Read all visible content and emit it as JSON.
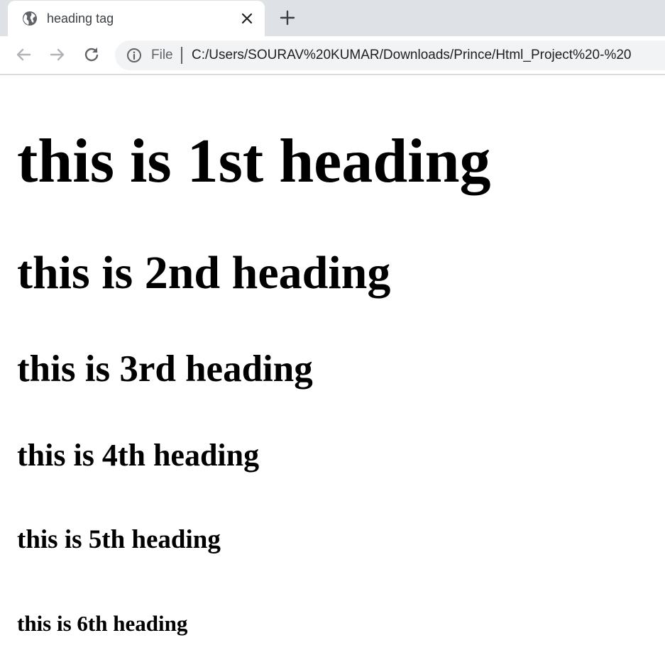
{
  "browser": {
    "tab": {
      "title": "heading tag",
      "favicon": "globe-icon"
    },
    "new_tab_icon": "plus-icon",
    "nav": {
      "back_icon": "back-arrow-icon",
      "forward_icon": "forward-arrow-icon",
      "reload_icon": "reload-icon"
    },
    "omnibox": {
      "info_icon": "info-icon",
      "scheme": "File",
      "url": "C:/Users/SOURAV%20KUMAR/Downloads/Prince/Html_Project%20-%20"
    }
  },
  "page": {
    "headings": [
      "this is 1st heading",
      "this is 2nd heading",
      "this is 3rd heading",
      "this is 4th heading",
      "this is 5th heading",
      "this is 6th heading"
    ]
  },
  "colors": {
    "tabstrip": "#dee1e6",
    "omnibox": "#f1f3f4",
    "text": "#000000"
  }
}
